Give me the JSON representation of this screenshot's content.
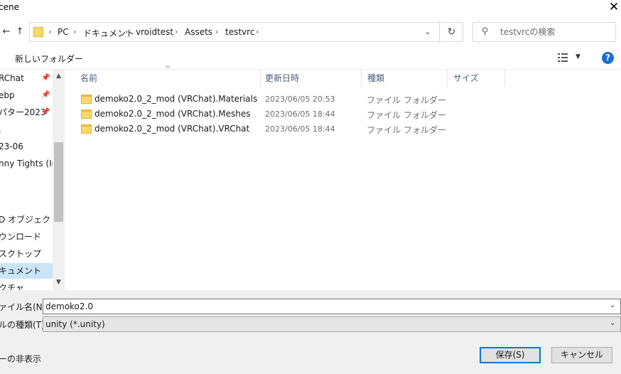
{
  "window": {
    "title": "cene",
    "close_glyph": "✕"
  },
  "nav": {
    "back_glyph": "←",
    "up_glyph": "↑",
    "breadcrumb": [
      "PC",
      "ドキュメント",
      "vroidtest",
      "Assets",
      "testvrc"
    ],
    "separator": "›",
    "dropdown_glyph": "⌄",
    "refresh_glyph": "↻",
    "search_placeholder": "testvrcの検索",
    "search_glyph": "⚲"
  },
  "toolbar": {
    "new_folder": "新しいフォルダー",
    "view_menu_glyph": "▼",
    "help": "?"
  },
  "sidebar": {
    "items": [
      {
        "label": "RChat",
        "pinned": true
      },
      {
        "label": "ebp",
        "pinned": true
      },
      {
        "label": "パター2023",
        "pinned": true
      },
      {
        "label": ".",
        "pinned": false
      },
      {
        "label": "23-06",
        "pinned": false
      },
      {
        "label": "nny Tights (In",
        "pinned": false
      },
      {
        "label": "",
        "pinned": false
      },
      {
        "label": "",
        "pinned": false
      },
      {
        "label": "D オブジェクト",
        "pinned": false
      },
      {
        "label": "ウンロード",
        "pinned": false
      },
      {
        "label": "スクトップ",
        "pinned": false
      },
      {
        "label": "キュメント",
        "pinned": false,
        "selected": true
      },
      {
        "label": "クチャ",
        "pinned": false
      }
    ],
    "pin_glyph": "📌",
    "scroll_up": "▲",
    "scroll_down": "▼"
  },
  "columns": {
    "name": "名前",
    "date": "更新日時",
    "type": "種類",
    "size": "サイズ",
    "sort_glyph": "^"
  },
  "files": [
    {
      "name": "demoko2.0_2_mod (VRChat).Materials",
      "date": "2023/06/05 20:53",
      "type": "ファイル フォルダー"
    },
    {
      "name": "demoko2.0_2_mod (VRChat).Meshes",
      "date": "2023/06/05 18:44",
      "type": "ファイル フォルダー"
    },
    {
      "name": "demoko2.0_2_mod (VRChat).VRChat",
      "date": "2023/06/05 18:44",
      "type": "ファイル フォルダー"
    }
  ],
  "bottom": {
    "filename_label": "ァイル名(N):",
    "filename_value": "demoko2.0",
    "filetype_label": "ルの種類(T):",
    "filetype_value": "unity (*.unity)",
    "dropdown_glyph": "⌄",
    "hide_folders": "ーの非表示",
    "save": "保存(S)",
    "cancel": "キャンセル"
  }
}
